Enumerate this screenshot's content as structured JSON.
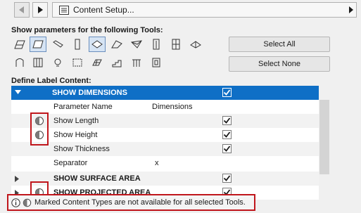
{
  "nav": {
    "back_icon": "triangle-left-icon",
    "forward_icon": "triangle-right-icon",
    "breadcrumb_icon": "settings-panel-icon",
    "breadcrumb": "Content Setup...",
    "expand_icon": "triangle-right-icon"
  },
  "tools_heading": "Show parameters for the following Tools:",
  "tools": [
    {
      "icon": "wall-tool-icon",
      "selected": false
    },
    {
      "icon": "slab-tool-icon",
      "selected": true
    },
    {
      "icon": "beam-tool-icon",
      "selected": false
    },
    {
      "icon": "column-tool-icon",
      "selected": false
    },
    {
      "icon": "roof-tool-icon",
      "selected": true
    },
    {
      "icon": "shell-tool-icon",
      "selected": false
    },
    {
      "icon": "morph-tool-icon",
      "selected": false
    },
    {
      "icon": "door-tool-icon",
      "selected": false
    },
    {
      "icon": "window-tool-icon",
      "selected": false
    },
    {
      "icon": "skylight-tool-icon",
      "selected": false
    },
    {
      "icon": "object-tool-icon",
      "selected": false
    },
    {
      "icon": "curtain-wall-tool-icon",
      "selected": false
    },
    {
      "icon": "lamp-tool-icon",
      "selected": false
    },
    {
      "icon": "zone-tool-icon",
      "selected": false
    },
    {
      "icon": "mesh-tool-icon",
      "selected": false
    },
    {
      "icon": "stair-tool-icon",
      "selected": false
    },
    {
      "icon": "railing-tool-icon",
      "selected": false
    },
    {
      "icon": "opening-tool-icon",
      "selected": false
    }
  ],
  "buttons": {
    "select_all": "Select All",
    "select_none": "Select None"
  },
  "define_heading": "Define Label Content:",
  "rows": [
    {
      "kind": "header",
      "expanded": true,
      "label": "SHOW DIMENSIONS",
      "value": "",
      "checked": true,
      "marked": false
    },
    {
      "kind": "item",
      "label": "Parameter Name",
      "value": "Dimensions",
      "checked": null,
      "marked": false
    },
    {
      "kind": "item",
      "label": "Show Length",
      "value": "",
      "checked": true,
      "marked": true
    },
    {
      "kind": "item",
      "label": "Show Height",
      "value": "",
      "checked": true,
      "marked": true
    },
    {
      "kind": "item",
      "label": "Show Thickness",
      "value": "",
      "checked": true,
      "marked": false
    },
    {
      "kind": "item",
      "label": "Separator",
      "value": "x",
      "checked": null,
      "marked": false
    },
    {
      "kind": "group",
      "expanded": false,
      "label": "SHOW SURFACE AREA",
      "value": "",
      "checked": true,
      "marked": false
    },
    {
      "kind": "group",
      "expanded": false,
      "label": "SHOW PROJECTED AREA",
      "value": "",
      "checked": true,
      "marked": true
    }
  ],
  "status": {
    "info_icon": "info-icon",
    "mark_icon": "half-circle-icon",
    "text": "Marked Content Types are not available for all selected Tools."
  },
  "colors": {
    "header_blue": "#0f6fc6",
    "highlight_red": "#c0161c"
  }
}
